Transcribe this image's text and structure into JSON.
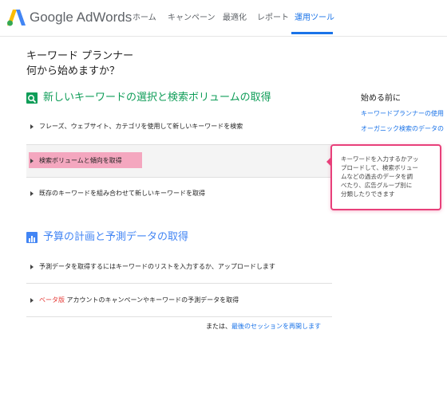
{
  "header": {
    "brand": "Google AdWords",
    "nav": [
      {
        "label": "ホーム"
      },
      {
        "label": "キャンペーン"
      },
      {
        "label": "最適化"
      },
      {
        "label": "レポート"
      },
      {
        "label": "運用ツール",
        "active": true
      }
    ]
  },
  "page": {
    "title": "キーワード プランナー",
    "subtitle": "何から始めますか？"
  },
  "section1": {
    "title": "新しいキーワードの選択と検索ボリュームの取得",
    "icon": "search-icon",
    "options": [
      {
        "label": "フレーズ、ウェブサイト、カテゴリを使用して新しいキーワードを検索"
      },
      {
        "label": "検索ボリュームと傾向を取得"
      },
      {
        "label": "既存のキーワードを組み合わせて新しいキーワードを取得"
      }
    ]
  },
  "section2": {
    "title": "予算の計画と予測データの取得",
    "icon": "bar-chart-icon",
    "options": [
      {
        "label": "予測データを取得するにはキーワードのリストを入力するか、アップロードします"
      },
      {
        "beta": "ベータ版",
        "label": " アカウントのキャンペーンやキーワードの予測データを取得"
      }
    ]
  },
  "footer": {
    "prefix": "または、",
    "link": "最後のセッションを再開します"
  },
  "sidebar": {
    "title": "始める前に",
    "links": [
      {
        "label": "キーワードプランナーの使用"
      },
      {
        "label": "オーガニック検索のデータの"
      }
    ]
  },
  "tooltip": {
    "lines": [
      "キーワードを入力するかアッ",
      "プロードして、検索ボリュー",
      "ムなどの過去のデータを調",
      "べたり、広告グループ別に",
      "分類したりできます"
    ]
  },
  "colors": {
    "accent": "#1a73e8",
    "section": "#0f9d58",
    "highlight": "#f4a7bf",
    "tooltip_border": "#e8407a",
    "beta": "#e53935"
  }
}
